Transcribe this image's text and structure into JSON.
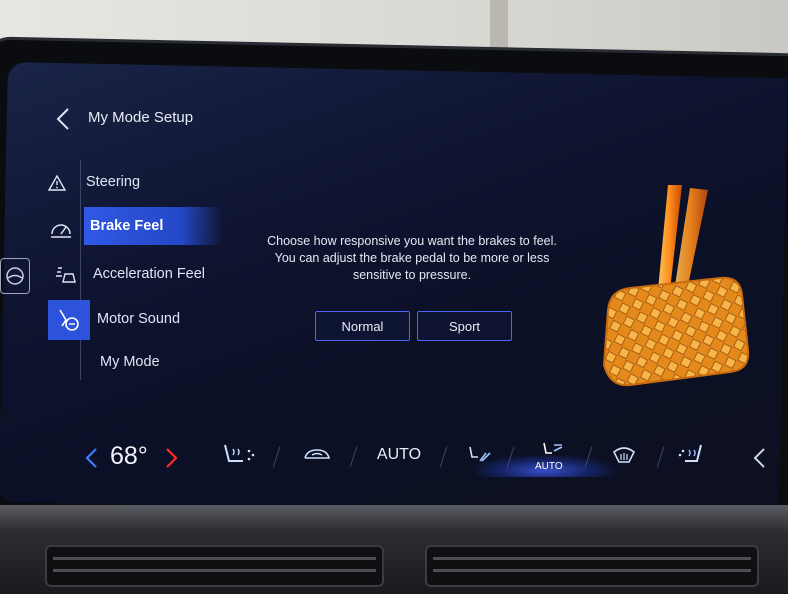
{
  "header": {
    "title": "My Mode Setup"
  },
  "sidebar": {
    "items": [
      {
        "label": "Steering",
        "icon": "warning-triangle-icon"
      },
      {
        "label": "Brake Feel",
        "icon": "gauge-icon",
        "selected": true
      },
      {
        "label": "Acceleration Feel",
        "icon": "acceleration-icon"
      },
      {
        "label": "Motor Sound",
        "icon": "motor-sound-icon"
      },
      {
        "label": "My Mode"
      }
    ]
  },
  "main": {
    "description": "Choose how responsive you want the brakes to feel. You can adjust the brake pedal to be more or less sensitive to pressure.",
    "options": [
      {
        "label": "Normal"
      },
      {
        "label": "Sport"
      }
    ]
  },
  "climate": {
    "temperature": "68°",
    "auto_label": "AUTO",
    "auto_mode_label": "AUTO",
    "icons": [
      "heated-seat-icon",
      "recirculation-icon",
      "airflow-feet-icon",
      "airflow-auto-icon",
      "defrost-icon",
      "seat-ventilation-icon"
    ]
  },
  "colors": {
    "accent": "#2f59e6",
    "button_border": "#4b63ff",
    "temp_down_arrow": "#3d7bff",
    "temp_up_arrow": "#ff2a2a",
    "pedal": "#f0a02a"
  }
}
